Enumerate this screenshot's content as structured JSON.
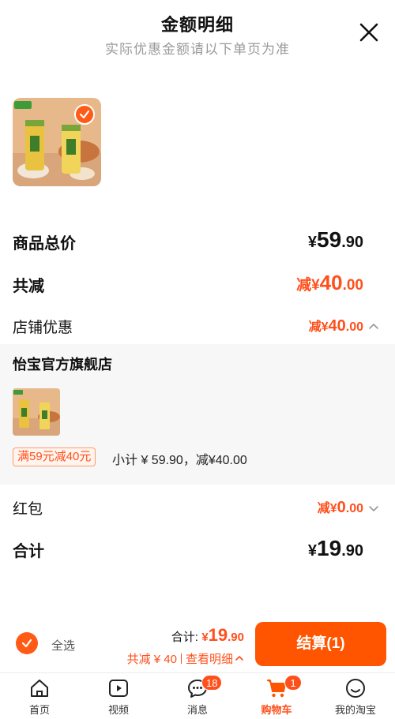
{
  "header": {
    "title": "金额明细",
    "subtitle": "实际优惠金额请以下单页为准"
  },
  "summary": {
    "goods_total_label": "商品总价",
    "goods_total": {
      "yen": "¥",
      "int": "59",
      "dec": ".90"
    },
    "discount_label": "共减",
    "discount": {
      "pre": "减¥",
      "int": "40",
      "dec": ".00"
    },
    "shop_discount_label": "店铺优惠",
    "shop_discount": {
      "pre": "减¥",
      "int": "40",
      "dec": ".00"
    }
  },
  "store": {
    "name": "怡宝官方旗舰店",
    "promo_tag": "满59元减40元",
    "subtotal": "小计 ¥ 59.90，减¥40.00"
  },
  "red_packet": {
    "label": "红包",
    "amount": {
      "pre": "减¥",
      "int": "0",
      "dec": ".00"
    }
  },
  "total": {
    "label": "合计",
    "amount": {
      "yen": "¥",
      "int": "19",
      "dec": ".90"
    }
  },
  "bottom_bar": {
    "select_all": "全选",
    "total_label": "合计:",
    "total_amount": {
      "yen": "¥",
      "int": "19",
      "dec": ".90"
    },
    "discount_text": "共减 ¥ 40",
    "view_detail": "查看明细",
    "checkout": "结算(1)"
  },
  "tabbar": {
    "items": [
      {
        "label": "首页",
        "icon": "home-icon"
      },
      {
        "label": "视频",
        "icon": "video-icon"
      },
      {
        "label": "消息",
        "icon": "message-icon",
        "badge": "18"
      },
      {
        "label": "购物车",
        "icon": "cart-icon",
        "badge": "1",
        "active": true
      },
      {
        "label": "我的淘宝",
        "icon": "profile-icon"
      }
    ]
  },
  "colors": {
    "accent": "#ff4f1b",
    "checkout_button": "#ff5400",
    "panel_bg": "#f7f7f7"
  }
}
